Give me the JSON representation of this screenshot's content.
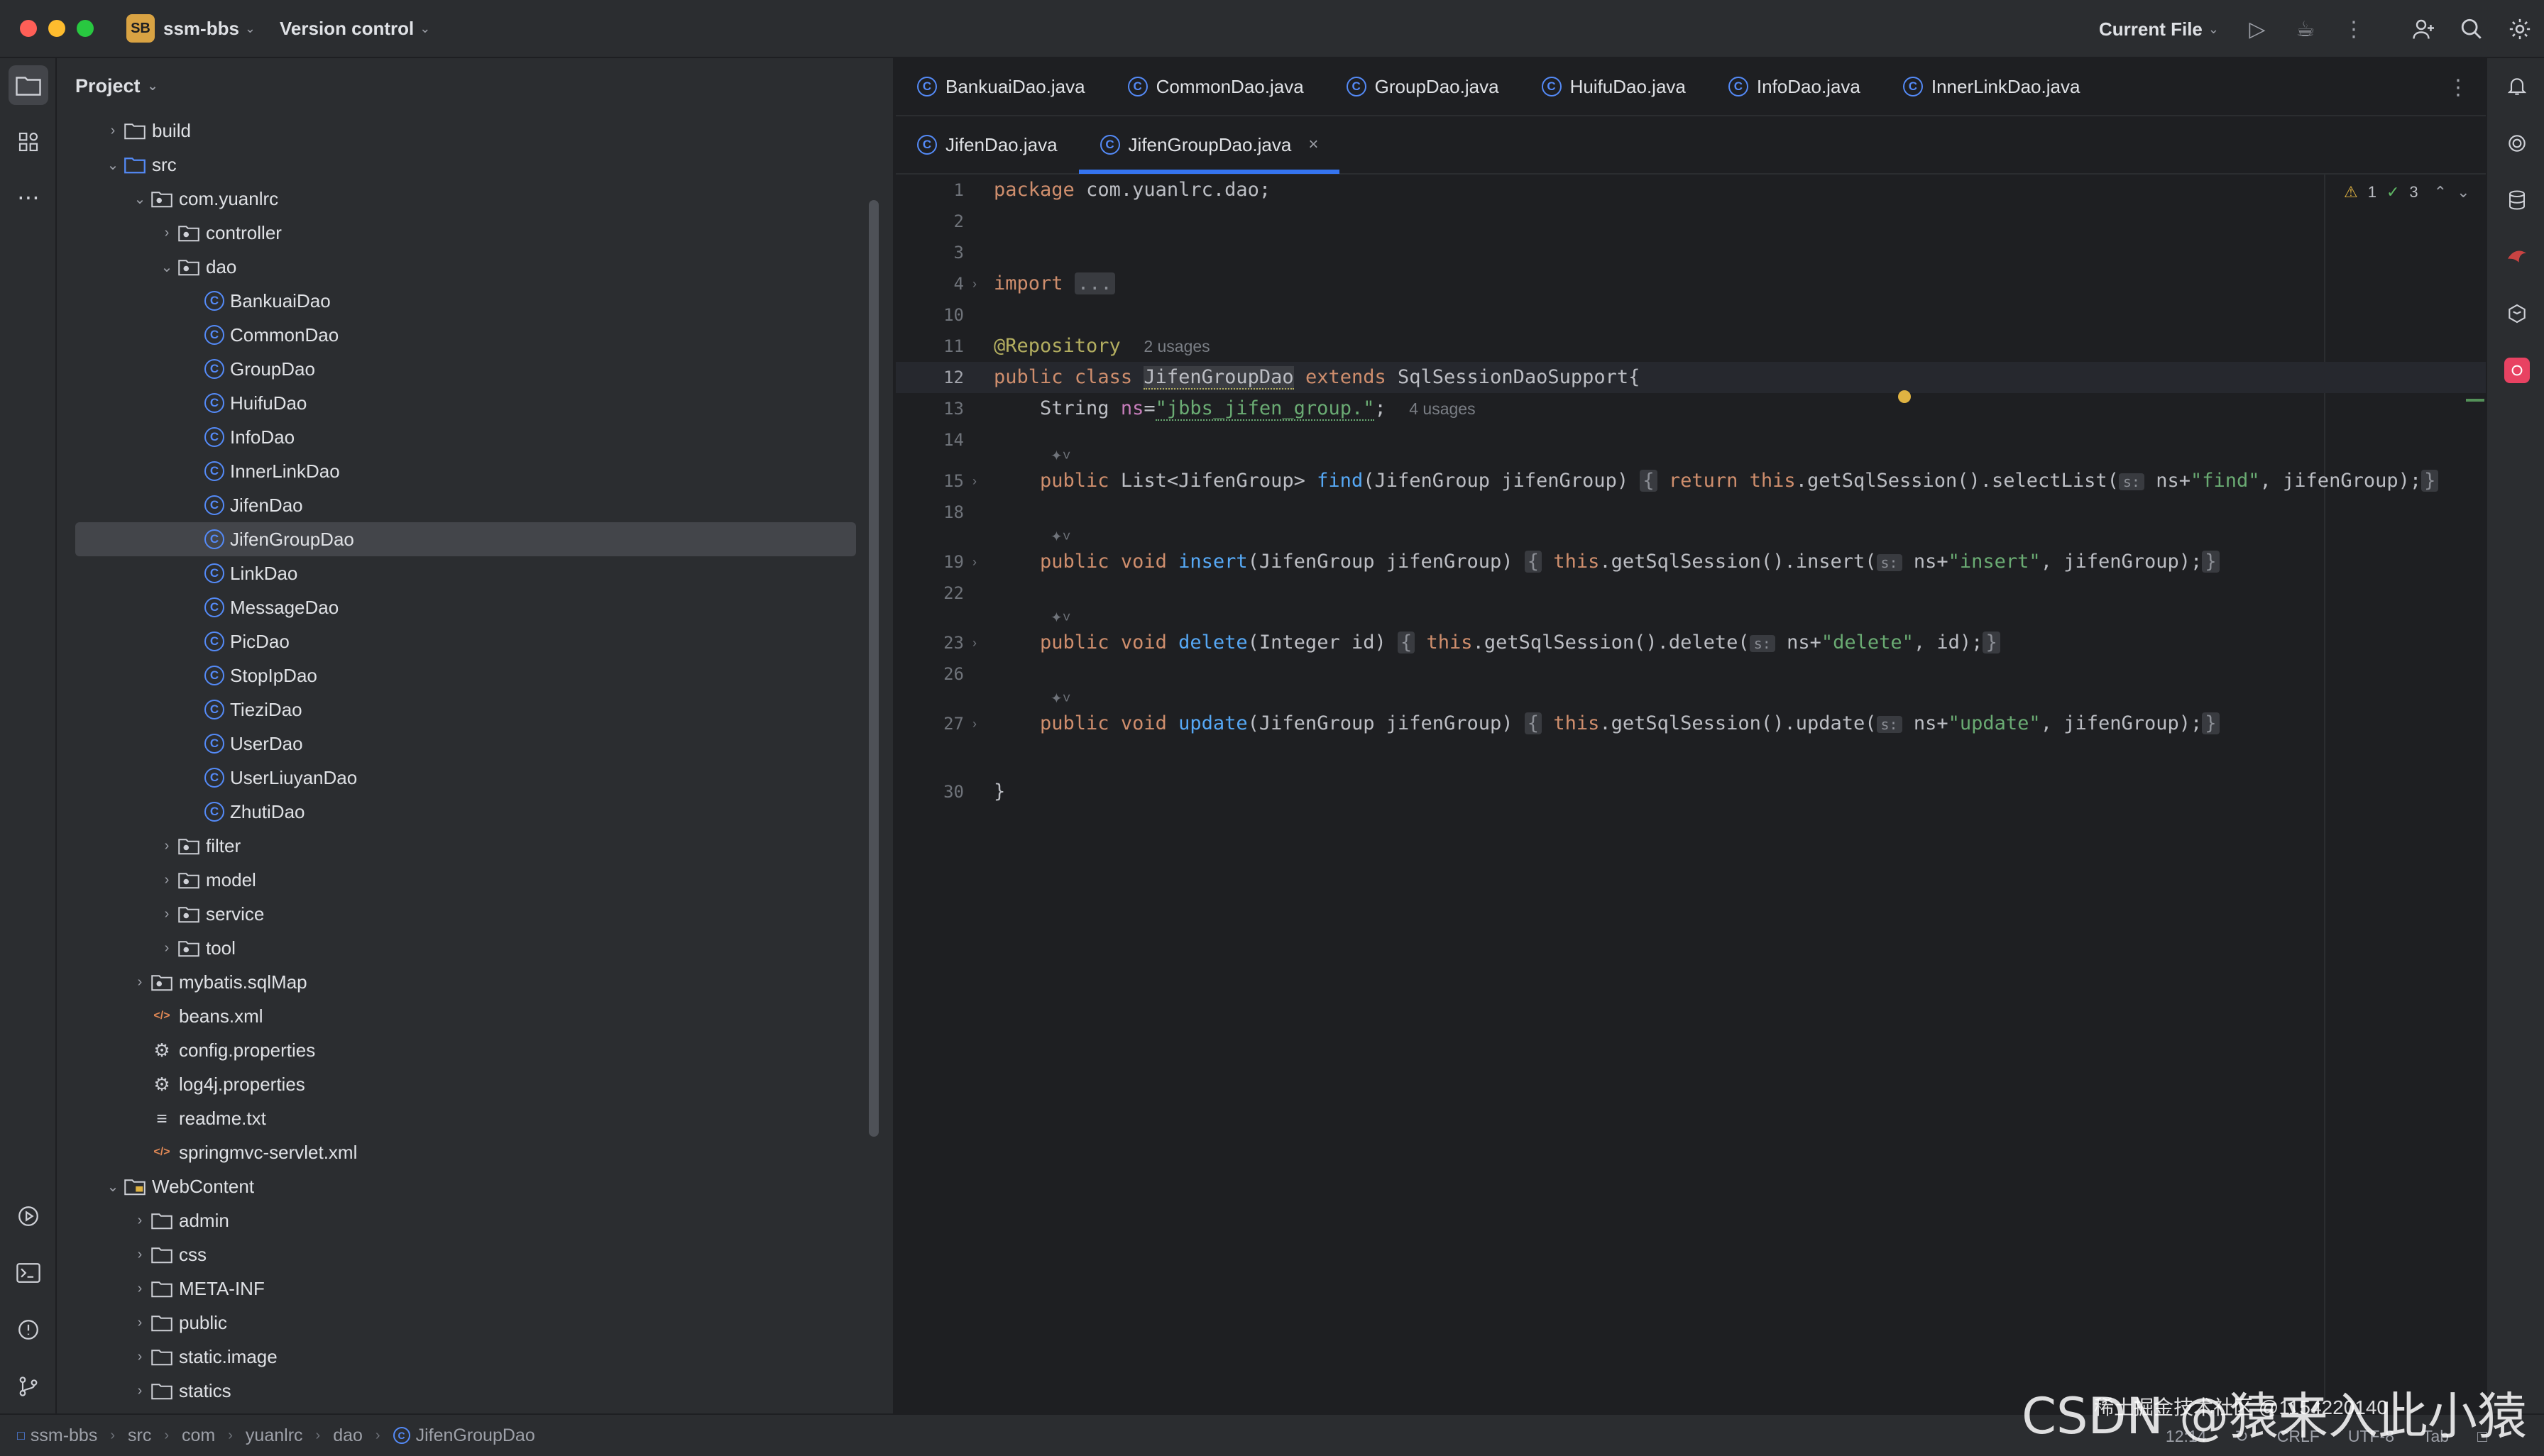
{
  "titlebar": {
    "project_badge": "SB",
    "project_name": "ssm-bbs",
    "vcs_label": "Version control",
    "run_config": "Current File"
  },
  "project_panel": {
    "title": "Project",
    "tree": [
      {
        "label": "build",
        "type": "folder",
        "depth": 1,
        "expanded": false
      },
      {
        "label": "src",
        "type": "folder-src",
        "depth": 1,
        "expanded": true
      },
      {
        "label": "com.yuanlrc",
        "type": "package",
        "depth": 2,
        "expanded": true
      },
      {
        "label": "controller",
        "type": "package",
        "depth": 3,
        "expanded": false
      },
      {
        "label": "dao",
        "type": "package",
        "depth": 3,
        "expanded": true
      },
      {
        "label": "BankuaiDao",
        "type": "class",
        "depth": 4
      },
      {
        "label": "CommonDao",
        "type": "class",
        "depth": 4
      },
      {
        "label": "GroupDao",
        "type": "class",
        "depth": 4
      },
      {
        "label": "HuifuDao",
        "type": "class",
        "depth": 4
      },
      {
        "label": "InfoDao",
        "type": "class",
        "depth": 4
      },
      {
        "label": "InnerLinkDao",
        "type": "class",
        "depth": 4
      },
      {
        "label": "JifenDao",
        "type": "class",
        "depth": 4
      },
      {
        "label": "JifenGroupDao",
        "type": "class",
        "depth": 4,
        "selected": true
      },
      {
        "label": "LinkDao",
        "type": "class",
        "depth": 4
      },
      {
        "label": "MessageDao",
        "type": "class",
        "depth": 4
      },
      {
        "label": "PicDao",
        "type": "class",
        "depth": 4
      },
      {
        "label": "StopIpDao",
        "type": "class",
        "depth": 4
      },
      {
        "label": "TieziDao",
        "type": "class",
        "depth": 4
      },
      {
        "label": "UserDao",
        "type": "class",
        "depth": 4
      },
      {
        "label": "UserLiuyanDao",
        "type": "class",
        "depth": 4
      },
      {
        "label": "ZhutiDao",
        "type": "class",
        "depth": 4
      },
      {
        "label": "filter",
        "type": "package",
        "depth": 3,
        "expanded": false
      },
      {
        "label": "model",
        "type": "package",
        "depth": 3,
        "expanded": false
      },
      {
        "label": "service",
        "type": "package",
        "depth": 3,
        "expanded": false
      },
      {
        "label": "tool",
        "type": "package",
        "depth": 3,
        "expanded": false
      },
      {
        "label": "mybatis.sqlMap",
        "type": "package",
        "depth": 2,
        "expanded": false
      },
      {
        "label": "beans.xml",
        "type": "xml",
        "depth": 2
      },
      {
        "label": "config.properties",
        "type": "properties",
        "depth": 2
      },
      {
        "label": "log4j.properties",
        "type": "properties",
        "depth": 2
      },
      {
        "label": "readme.txt",
        "type": "text",
        "depth": 2
      },
      {
        "label": "springmvc-servlet.xml",
        "type": "xml",
        "depth": 2
      },
      {
        "label": "WebContent",
        "type": "folder-web",
        "depth": 1,
        "expanded": true
      },
      {
        "label": "admin",
        "type": "folder",
        "depth": 2,
        "expanded": false
      },
      {
        "label": "css",
        "type": "folder",
        "depth": 2,
        "expanded": false
      },
      {
        "label": "META-INF",
        "type": "folder",
        "depth": 2,
        "expanded": false
      },
      {
        "label": "public",
        "type": "folder",
        "depth": 2,
        "expanded": false
      },
      {
        "label": "static.image",
        "type": "folder",
        "depth": 2,
        "expanded": false
      },
      {
        "label": "statics",
        "type": "folder",
        "depth": 2,
        "expanded": false
      }
    ]
  },
  "editor": {
    "tabs_row1": [
      "BankuaiDao.java",
      "CommonDao.java",
      "GroupDao.java",
      "HuifuDao.java",
      "InfoDao.java",
      "InnerLinkDao.java"
    ],
    "tabs_row2": [
      "JifenDao.java",
      "JifenGroupDao.java"
    ],
    "active_tab": "JifenGroupDao.java",
    "inspection": {
      "warnings": "1",
      "ok": "3"
    },
    "code": {
      "package_kw": "package",
      "package_name": "com.yuanlrc.dao;",
      "import_kw": "import",
      "import_fold": "...",
      "annotation": "@Repository",
      "annotation_usages": "2 usages",
      "class_decl": {
        "public": "public",
        "class": "class",
        "name": "JifenGroupDao",
        "extends": "extends",
        "super": "SqlSessionDaoSupport{"
      },
      "ns_line": {
        "type": "String ",
        "var": "ns",
        "eq": "=",
        "value": "\"jbbs_jifen_group.\"",
        "end": ";",
        "usages": "4 usages"
      },
      "methods": [
        {
          "sig_pre": "public List<JifenGroup> ",
          "name": "find",
          "params": "(JifenGroup jifenGroup)",
          "body_kw": "return this",
          "body": ".getSqlSession().selectList(",
          "hint": "s:",
          "arg_ns": "ns+",
          "arg_str": "\"find\"",
          "arg_rest": ", jifenGroup);"
        },
        {
          "sig_pre": "public void ",
          "name": "insert",
          "params": "(JifenGroup jifenGroup)",
          "body_kw": "this",
          "body": ".getSqlSession().insert(",
          "hint": "s:",
          "arg_ns": "ns+",
          "arg_str": "\"insert\"",
          "arg_rest": ", jifenGroup);"
        },
        {
          "sig_pre": "public void ",
          "name": "delete",
          "params": "(Integer id)",
          "body_kw": "this",
          "body": ".getSqlSession().delete(",
          "hint": "s:",
          "arg_ns": "ns+",
          "arg_str": "\"delete\"",
          "arg_rest": ", id);"
        },
        {
          "sig_pre": "public void ",
          "name": "update",
          "params": "(JifenGroup jifenGroup)",
          "body_kw": "this",
          "body": ".getSqlSession().update(",
          "hint": "s:",
          "arg_ns": "ns+",
          "arg_str": "\"update\"",
          "arg_rest": ", jifenGroup);"
        }
      ],
      "closing": "}",
      "line_numbers": [
        "1",
        "2",
        "3",
        "4",
        "10",
        "11",
        "12",
        "13",
        "14",
        "15",
        "18",
        "19",
        "22",
        "23",
        "26",
        "27",
        "30"
      ]
    }
  },
  "statusbar": {
    "breadcrumb": [
      "ssm-bbs",
      "src",
      "com",
      "yuanlrc",
      "dao",
      "JifenGroupDao"
    ],
    "position": "12:14",
    "line_sep": "CRLF",
    "encoding": "UTF-8",
    "indent": "Tab"
  },
  "watermark": "CSDN @猿来入此小猿",
  "watermark_small": "稀土掘金技术社区 @1154220140"
}
